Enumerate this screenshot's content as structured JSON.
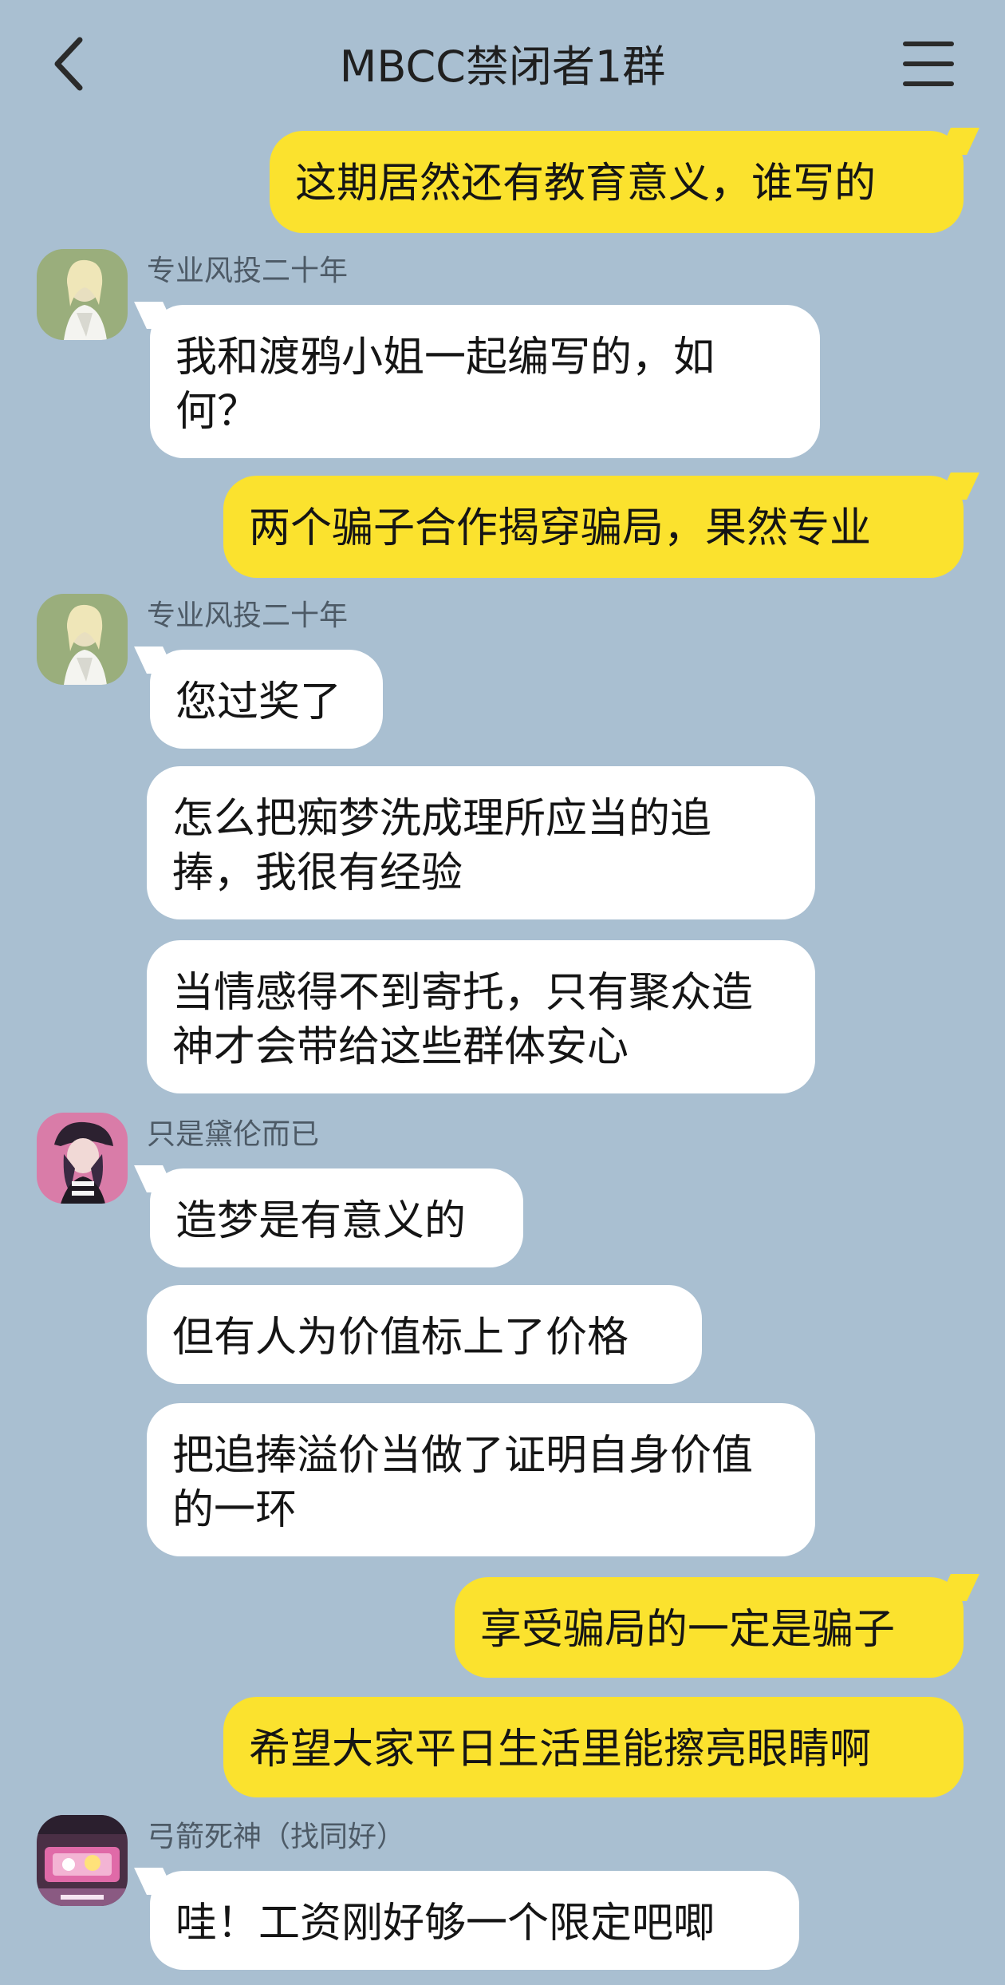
{
  "header": {
    "title": "MBCC禁闭者1群",
    "back_icon": "back-chevron-icon",
    "menu_icon": "hamburger-menu-icon"
  },
  "colors": {
    "background": "#a9bfd1",
    "my_bubble": "#fbe22e",
    "other_bubble": "#ffffff"
  },
  "messages": [
    {
      "text": "这期居然还有教育意义，谁写的"
    },
    {
      "sender": "专业风投二十年",
      "text": "我和渡鸦小姐一起编写的，如何？"
    },
    {
      "text": "两个骗子合作揭穿骗局，果然专业"
    },
    {
      "sender": "专业风投二十年",
      "text": "您过奖了"
    },
    {
      "text": "怎么把痴梦洗成理所应当的追捧，我很有经验"
    },
    {
      "text": "当情感得不到寄托，只有聚众造神才会带给这些群体安心"
    },
    {
      "sender": "只是黛伦而已",
      "text": "造梦是有意义的"
    },
    {
      "text": "但有人为价值标上了价格"
    },
    {
      "text": "把追捧溢价当做了证明自身价值的一环"
    },
    {
      "text": "享受骗局的一定是骗子"
    },
    {
      "text": "希望大家平日生活里能擦亮眼睛啊"
    },
    {
      "sender": "弓箭死神（找同好）",
      "text": "哇！工资刚好够一个限定吧唧"
    }
  ]
}
